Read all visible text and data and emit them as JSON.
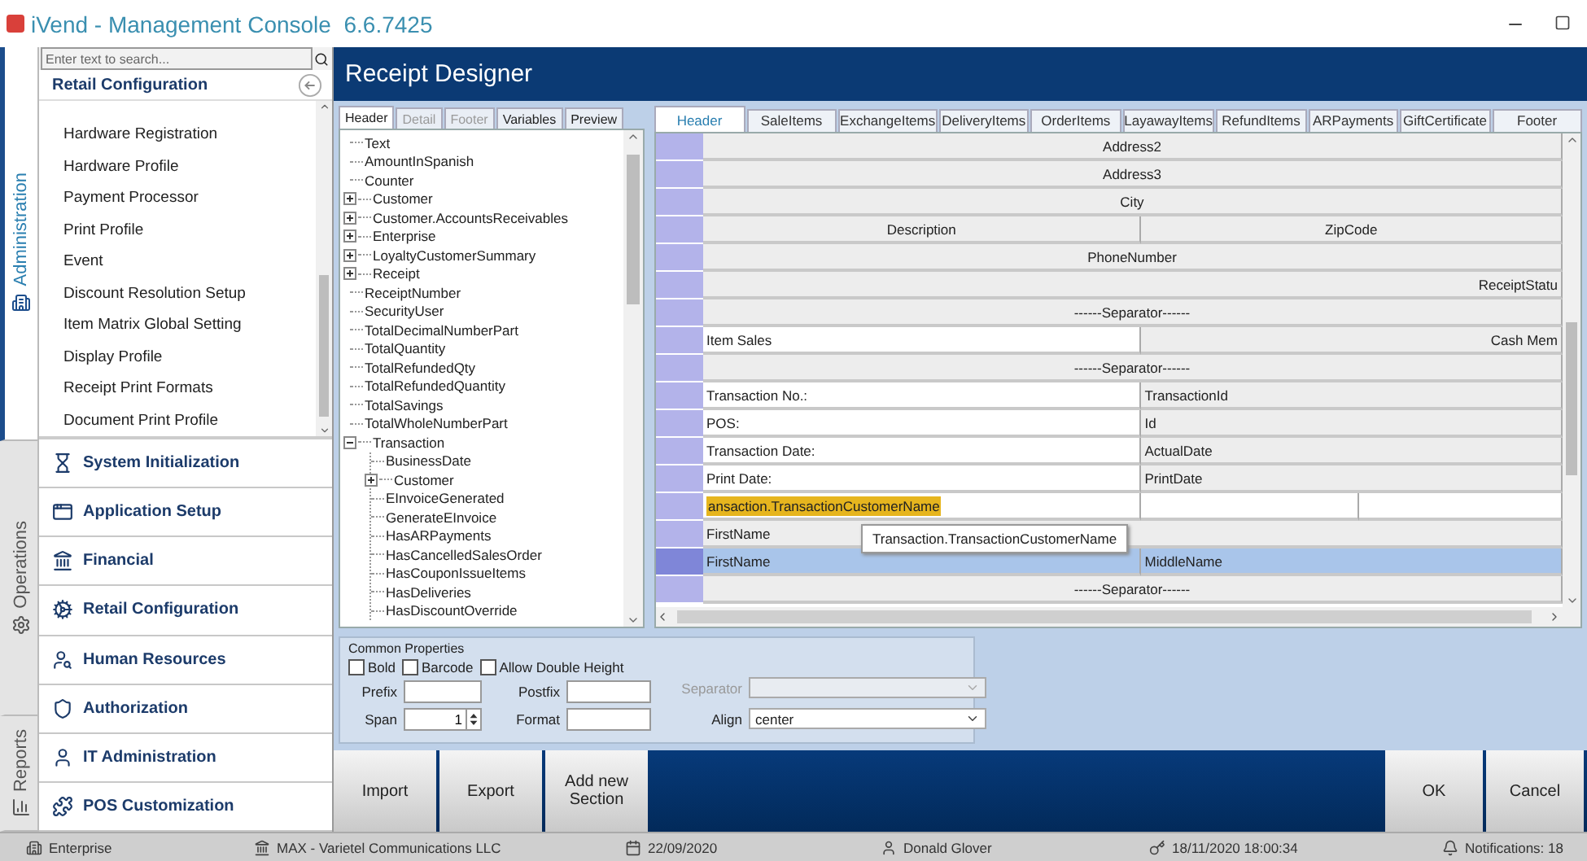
{
  "window": {
    "title": "iVend - Management Console",
    "version": "6.6.7425"
  },
  "side_tabs": [
    {
      "label": "Administration",
      "selected": true
    },
    {
      "label": "Operations",
      "selected": false
    },
    {
      "label": "Reports",
      "selected": false
    }
  ],
  "sidebar": {
    "search": {
      "placeholder": "Enter text to search..."
    },
    "section_title": "Retail Configuration",
    "items": [
      "Hardware Registration",
      "Hardware Profile",
      "Payment Processor",
      "Print Profile",
      "Event",
      "Discount Resolution Setup",
      "Item Matrix Global Setting",
      "Display Profile",
      "Receipt Print Formats",
      "Document Print Profile"
    ],
    "modules": [
      "System Initialization",
      "Application Setup",
      "Financial",
      "Retail Configuration",
      "Human Resources",
      "Authorization",
      "IT Administration",
      "POS Customization"
    ]
  },
  "main": {
    "title": "Receipt Designer",
    "tree_tabs": [
      {
        "label": "Header",
        "selected": true,
        "disabled": false
      },
      {
        "label": "Detail",
        "selected": false,
        "disabled": true
      },
      {
        "label": "Footer",
        "selected": false,
        "disabled": true
      },
      {
        "label": "Variables",
        "selected": false,
        "disabled": false
      },
      {
        "label": "Preview",
        "selected": false,
        "disabled": false
      }
    ],
    "tree": [
      {
        "label": "Text",
        "kind": "leaf"
      },
      {
        "label": "AmountInSpanish",
        "kind": "leaf"
      },
      {
        "label": "Counter",
        "kind": "leaf"
      },
      {
        "label": "Customer",
        "kind": "group",
        "expanded": false
      },
      {
        "label": "Customer.AccountsReceivables",
        "kind": "group",
        "expanded": false
      },
      {
        "label": "Enterprise",
        "kind": "group",
        "expanded": false
      },
      {
        "label": "LoyaltyCustomerSummary",
        "kind": "group",
        "expanded": false
      },
      {
        "label": "Receipt",
        "kind": "group",
        "expanded": false
      },
      {
        "label": "ReceiptNumber",
        "kind": "leaf"
      },
      {
        "label": "SecurityUser",
        "kind": "leaf"
      },
      {
        "label": "TotalDecimalNumberPart",
        "kind": "leaf"
      },
      {
        "label": "TotalQuantity",
        "kind": "leaf"
      },
      {
        "label": "TotalRefundedQty",
        "kind": "leaf"
      },
      {
        "label": "TotalRefundedQuantity",
        "kind": "leaf"
      },
      {
        "label": "TotalSavings",
        "kind": "leaf"
      },
      {
        "label": "TotalWholeNumberPart",
        "kind": "leaf"
      },
      {
        "label": "Transaction",
        "kind": "group",
        "expanded": true,
        "children": [
          {
            "label": "BusinessDate",
            "kind": "leaf"
          },
          {
            "label": "Customer",
            "kind": "group",
            "expanded": false
          },
          {
            "label": "EInvoiceGenerated",
            "kind": "leaf"
          },
          {
            "label": "GenerateEInvoice",
            "kind": "leaf"
          },
          {
            "label": "HasARPayments",
            "kind": "leaf"
          },
          {
            "label": "HasCancelledSalesOrder",
            "kind": "leaf"
          },
          {
            "label": "HasCouponIssueItems",
            "kind": "leaf"
          },
          {
            "label": "HasDeliveries",
            "kind": "leaf"
          },
          {
            "label": "HasDiscountOverride",
            "kind": "leaf"
          }
        ]
      }
    ],
    "designer_tabs": [
      {
        "label": "Header",
        "selected": true
      },
      {
        "label": "SaleItems",
        "selected": false
      },
      {
        "label": "ExchangeItems",
        "selected": false
      },
      {
        "label": "DeliveryItems",
        "selected": false
      },
      {
        "label": "OrderItems",
        "selected": false
      },
      {
        "label": "LayawayItems",
        "selected": false
      },
      {
        "label": "RefundItems",
        "selected": false
      },
      {
        "label": "ARPayments",
        "selected": false
      },
      {
        "label": "GiftCertificate",
        "selected": false
      },
      {
        "label": "Footer",
        "selected": false
      }
    ],
    "grid": {
      "tooltip": "Transaction.TransactionCustomerName",
      "rows": [
        {
          "selected": false,
          "cells": [
            {
              "kind": "centered",
              "text": "Address2"
            }
          ]
        },
        {
          "selected": false,
          "cells": [
            {
              "kind": "centered",
              "text": "Address3"
            }
          ]
        },
        {
          "selected": false,
          "cells": [
            {
              "kind": "centered",
              "text": "City"
            }
          ]
        },
        {
          "selected": false,
          "cells": [
            {
              "kind": "centered",
              "text": "Description"
            },
            {
              "kind": "centered",
              "text": "ZipCode"
            }
          ]
        },
        {
          "selected": false,
          "cells": [
            {
              "kind": "centered",
              "text": "PhoneNumber"
            }
          ]
        },
        {
          "selected": false,
          "cells": [
            {
              "kind": "end",
              "text": "ReceiptStatu"
            }
          ]
        },
        {
          "selected": false,
          "cells": [
            {
              "kind": "centered",
              "text": "------Separator------"
            }
          ]
        },
        {
          "selected": false,
          "cells": [
            {
              "kind": "label",
              "text": "Item Sales"
            },
            {
              "kind": "end",
              "text": "Cash Mem"
            }
          ]
        },
        {
          "selected": false,
          "cells": [
            {
              "kind": "centered",
              "text": "------Separator------"
            }
          ]
        },
        {
          "selected": false,
          "cells": [
            {
              "kind": "label",
              "text": "Transaction No.:"
            },
            {
              "kind": "value",
              "text": "TransactionId"
            }
          ]
        },
        {
          "selected": false,
          "cells": [
            {
              "kind": "label",
              "text": "POS:"
            },
            {
              "kind": "value",
              "text": "Id"
            }
          ]
        },
        {
          "selected": false,
          "cells": [
            {
              "kind": "label",
              "text": "Transaction Date:"
            },
            {
              "kind": "value",
              "text": "ActualDate"
            }
          ]
        },
        {
          "selected": false,
          "cells": [
            {
              "kind": "label",
              "text": "Print Date:"
            },
            {
              "kind": "value",
              "text": "PrintDate"
            }
          ]
        },
        {
          "selected": false,
          "cells": [
            {
              "kind": "highlighted",
              "text": "ansaction.TransactionCustomerName"
            },
            {
              "kind": "blank"
            },
            {
              "kind": "blank"
            }
          ]
        },
        {
          "selected": false,
          "cells": [
            {
              "kind": "value",
              "text": "FirstName"
            }
          ]
        },
        {
          "selected": true,
          "cells": [
            {
              "kind": "value",
              "text": "FirstName"
            },
            {
              "kind": "value",
              "text": "MiddleName"
            }
          ]
        },
        {
          "selected": false,
          "cells": [
            {
              "kind": "centered",
              "text": "------Separator------"
            }
          ]
        }
      ]
    },
    "common_properties": {
      "title": "Common Properties",
      "checkboxes": [
        {
          "label": "Bold",
          "checked": false
        },
        {
          "label": "Barcode",
          "checked": false
        },
        {
          "label": "Allow Double Height",
          "checked": false
        }
      ],
      "fields": [
        {
          "label": "Prefix",
          "kind": "text"
        },
        {
          "label": "Postfix",
          "kind": "text"
        },
        {
          "label": "Span",
          "kind": "spinner",
          "value": "1"
        },
        {
          "label": "Format",
          "kind": "text"
        }
      ],
      "dropdowns": [
        {
          "label": "Separator",
          "disabled": true
        },
        {
          "label": "Align",
          "value": "center",
          "disabled": false
        }
      ]
    },
    "buttons_left": [
      "Import",
      "Export",
      "Add new Section"
    ],
    "buttons_right": [
      "OK",
      "Cancel"
    ]
  },
  "status_bar": [
    "Enterprise",
    "MAX - Varietel Communications LLC",
    "22/09/2020",
    "Donald Glover",
    "18/11/2020 18:00:34",
    "Notifications: 18"
  ]
}
